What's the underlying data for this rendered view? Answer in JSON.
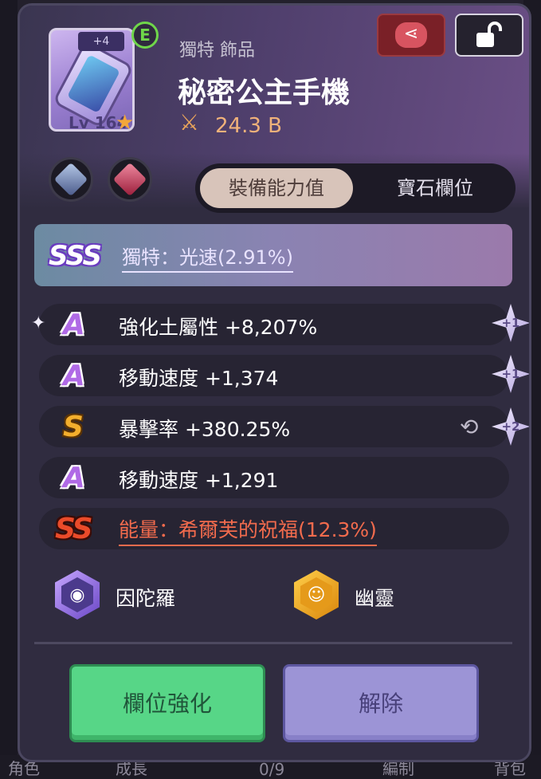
{
  "item": {
    "enhance": "+4",
    "tier_badge": "E",
    "level": "Lv 164",
    "type": "獨特 飾品",
    "name": "秘密公主手機",
    "power": "24.3 B"
  },
  "tabs": {
    "active": "裝備能力值",
    "inactive": "寶石欄位"
  },
  "unique_option": {
    "grade": "SSS",
    "text": "獨特：光速(2.91%)"
  },
  "stats": [
    {
      "grade": "A",
      "text": "強化土屬性 +8,207%",
      "bonus": "+1"
    },
    {
      "grade": "A",
      "text": "移動速度 +1,374",
      "bonus": "+1"
    },
    {
      "grade": "S",
      "text": "暴擊率 +380.25%",
      "bonus": "+2"
    },
    {
      "grade": "A",
      "text": "移動速度 +1,291"
    },
    {
      "grade": "SS",
      "text": "能量：希爾芙的祝福(12.3%)"
    }
  ],
  "sets": [
    {
      "label": "因陀羅",
      "icon": "indra-set-icon"
    },
    {
      "label": "幽靈",
      "icon": "ghost-set-icon"
    }
  ],
  "buttons": {
    "upgrade": "欄位強化",
    "unequip": "解除"
  },
  "bottom_nav": {
    "item1": "角色",
    "item2": "成長",
    "item3": "0/9",
    "item4": "編制",
    "item5": "背包"
  },
  "colors": {
    "upgrade_button": "#57d687",
    "unequip_button": "#9c94d6",
    "share_button": "#7a2027",
    "grade_a": "#b06ae6",
    "grade_s": "#f3ae2d",
    "grade_ss": "#ea4b2a",
    "sss_option_text": "#e9e3ff"
  }
}
